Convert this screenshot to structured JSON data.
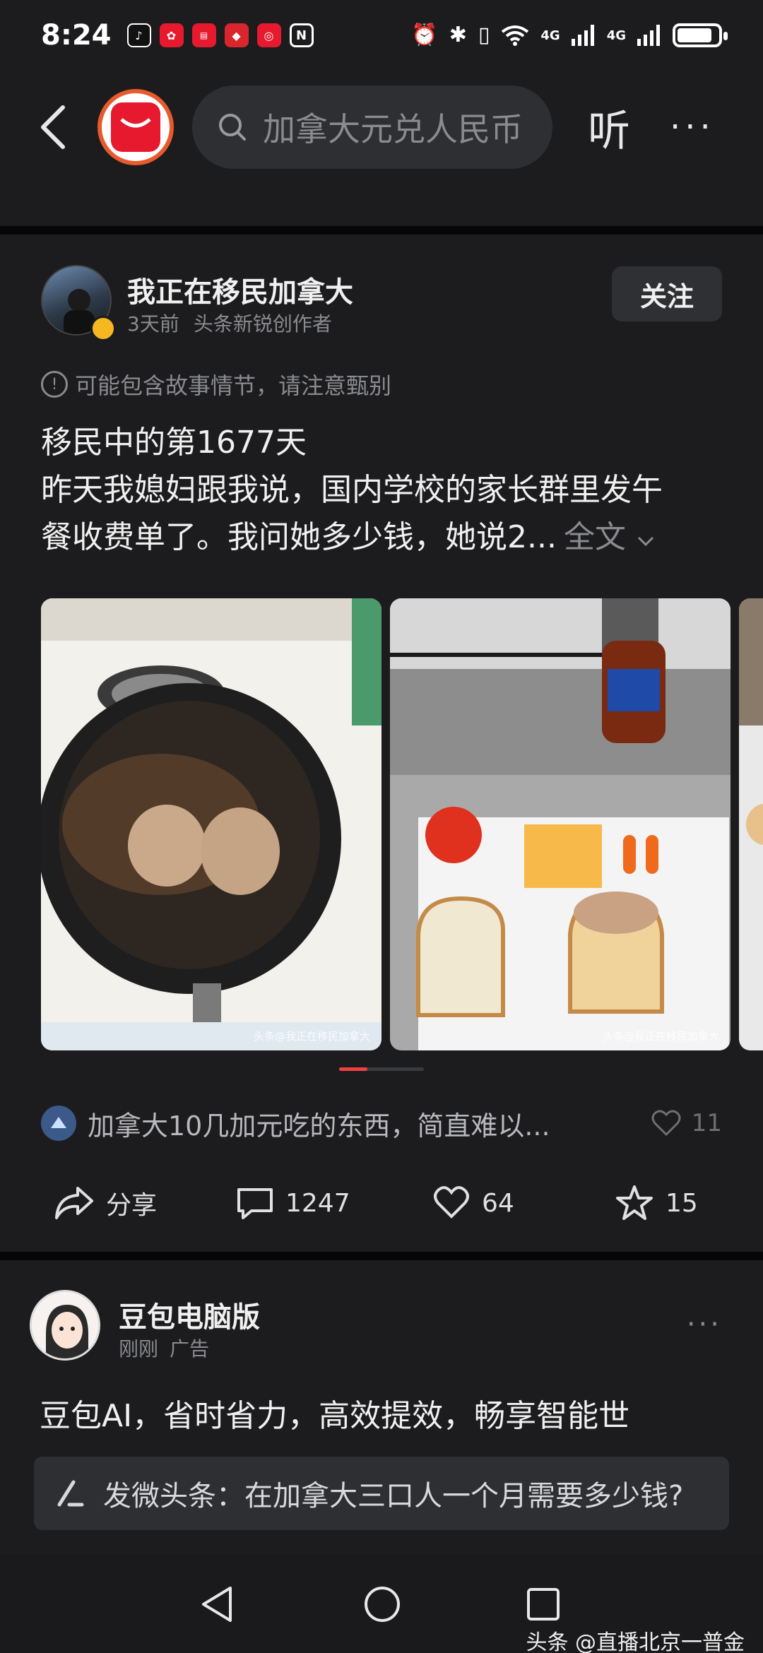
{
  "status_bar": {
    "time": "8:24",
    "network_1": "4G",
    "network_2": "4G",
    "battery_percent": 85
  },
  "top_bar": {
    "search_placeholder": "加拿大元兑人民币",
    "listen_label": "听",
    "more_label": "···"
  },
  "post": {
    "author_name": "我正在移民加拿大",
    "time_ago": "3天前",
    "author_tag": "头条新锐创作者",
    "follow_label": "关注",
    "notice": "可能包含故事情节，请注意甄别",
    "text_line_1": "移民中的第1677天",
    "text_line_2": "昨天我媳妇跟我说，国内学校的家长群里发午",
    "text_line_3": "餐收费单了。我问她多少钱，她说2...",
    "full_text_label": "全文",
    "watermark_1": "头条@我正在移民加拿大",
    "watermark_2": "头条@我正在移民加拿大",
    "related_text": "加拿大10几加元吃的东西，简直难以...",
    "related_likes": "11",
    "share_label": "分享",
    "comments": "1247",
    "likes": "64",
    "favorites": "15"
  },
  "ad": {
    "name": "豆包电脑版",
    "time": "刚刚",
    "tag": "广告",
    "text": "豆包AI，省时省力，高效提效，畅享智能世",
    "more_label": "···"
  },
  "compose": {
    "text": "发微头条：在加拿大三口人一个月需要多少钱?"
  },
  "bottom": {
    "credit": "头条 @直播北京一普金"
  },
  "colors": {
    "background": "#1c1c1e",
    "accent_red": "#f04142",
    "divider": "#060606"
  }
}
